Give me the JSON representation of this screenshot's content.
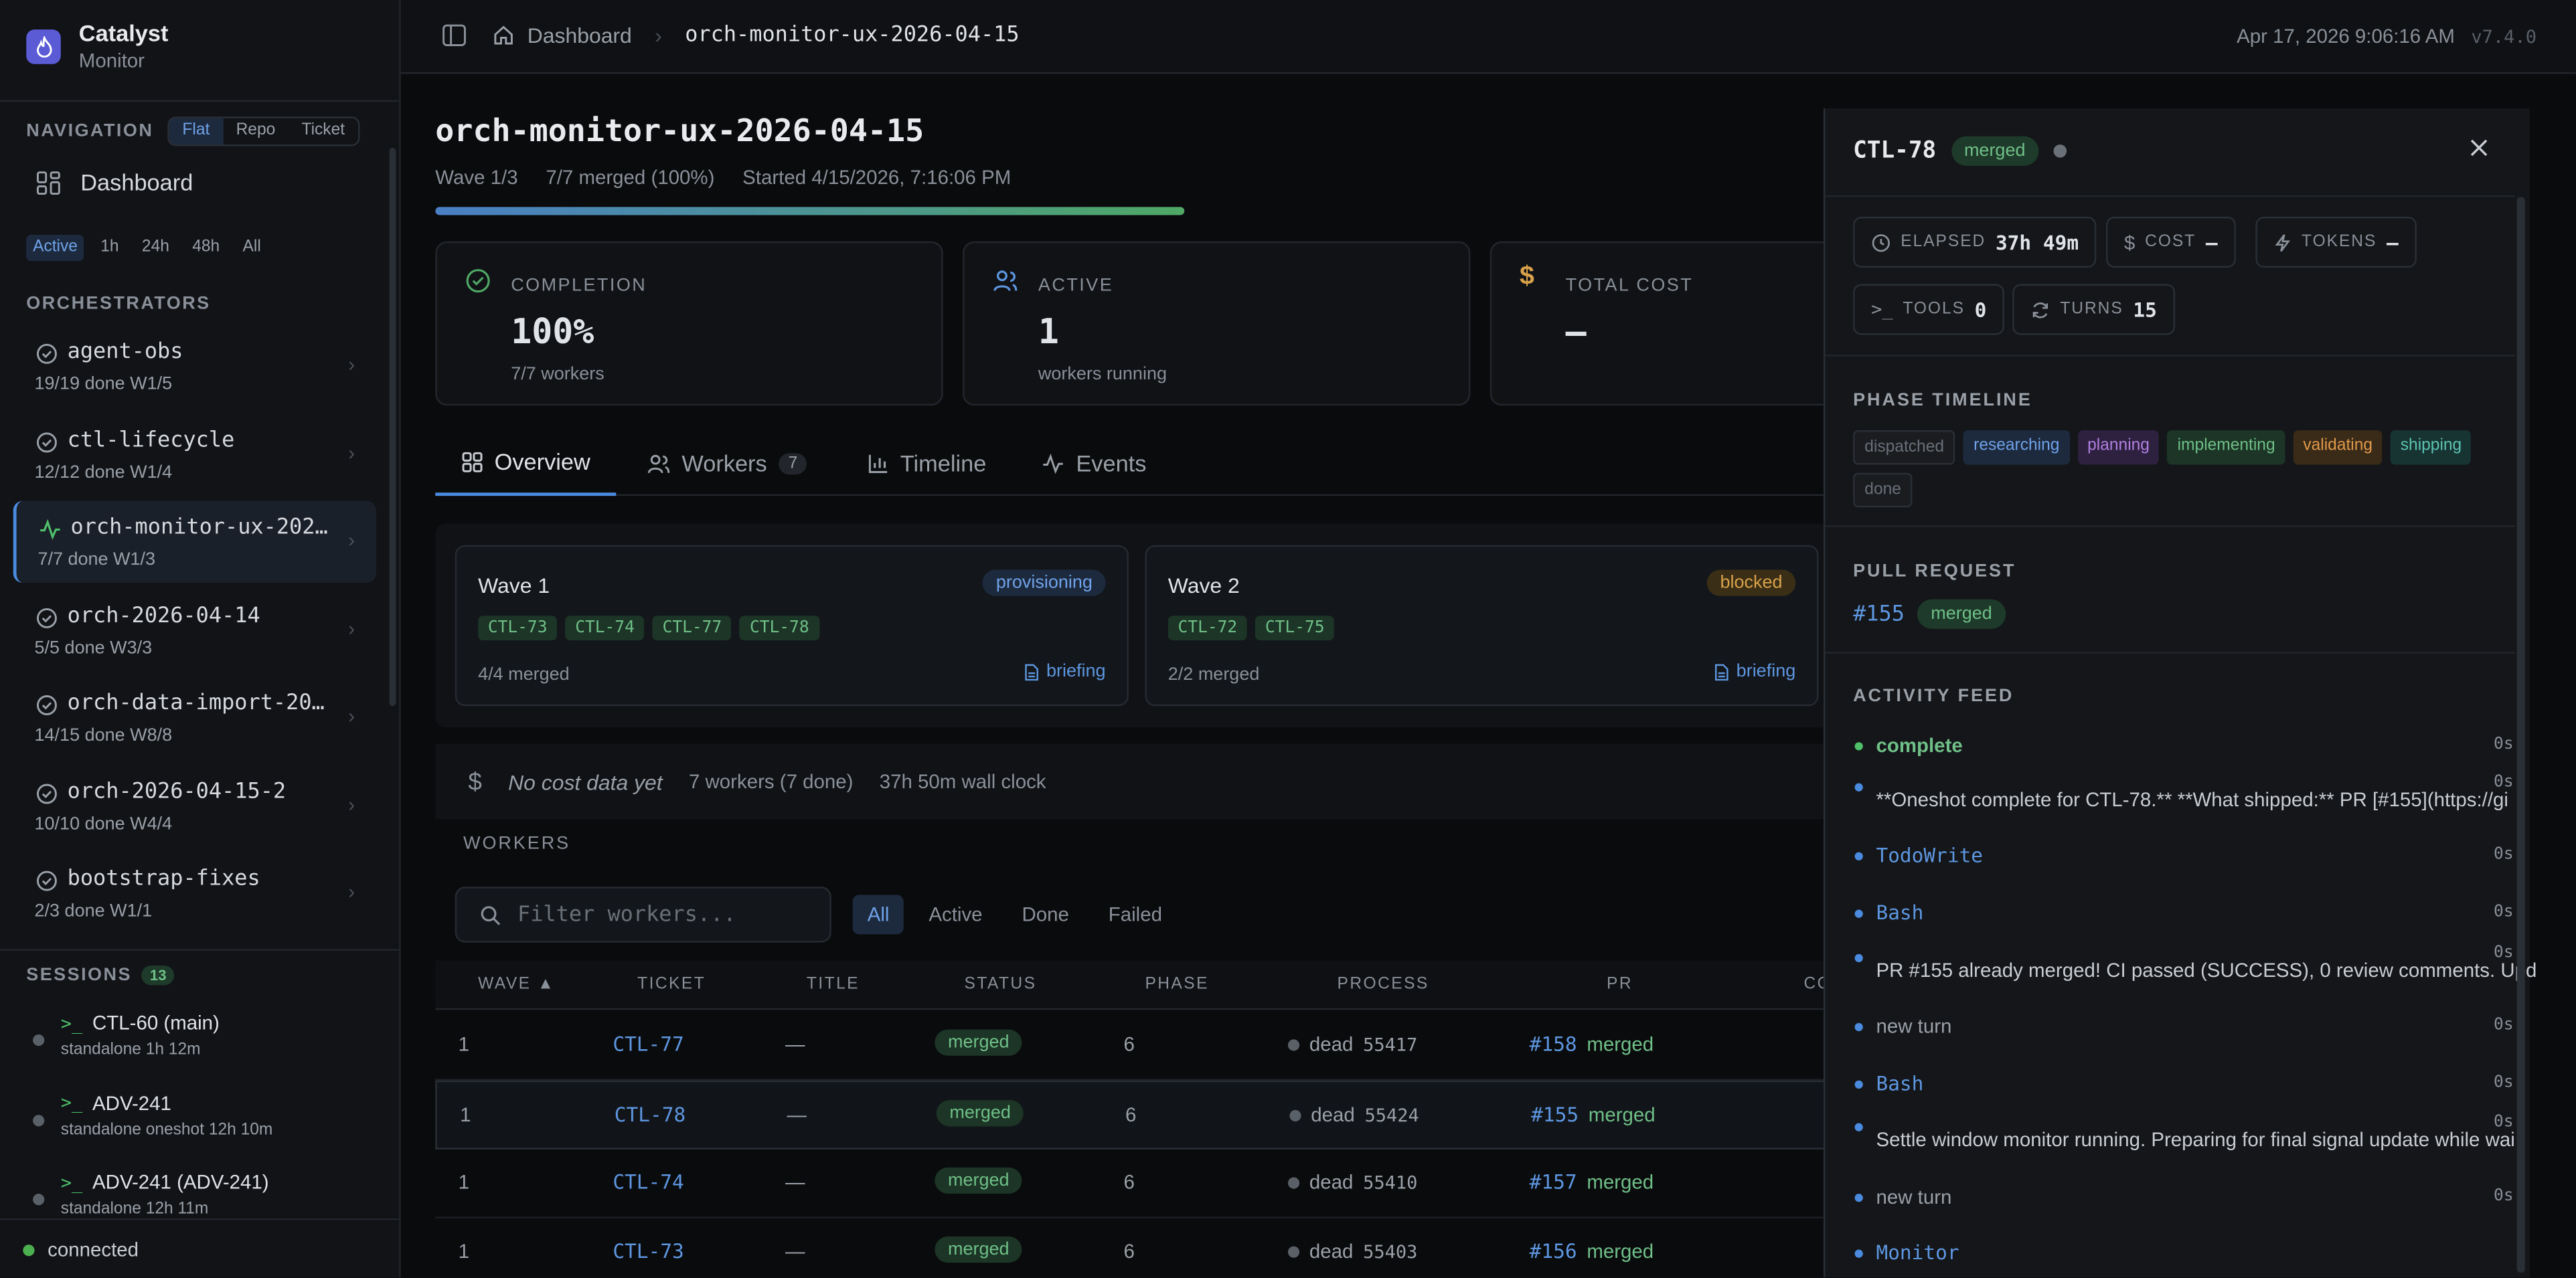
{
  "sidebar": {
    "brand_title": "Catalyst",
    "brand_subtitle": "Monitor",
    "navigation_label": "NAVIGATION",
    "view_modes": [
      "Flat",
      "Repo",
      "Ticket"
    ],
    "view_mode_selected": "Flat",
    "dashboard_label": "Dashboard",
    "time_ranges": [
      "Active",
      "1h",
      "24h",
      "48h",
      "All"
    ],
    "time_range_selected": "Active",
    "orchestrators_label": "ORCHESTRATORS",
    "orchestrators": [
      {
        "name": "agent-obs",
        "meta": "19/19 done  W1/5",
        "icon": "check-circle-icon"
      },
      {
        "name": "ctl-lifecycle",
        "meta": "12/12 done  W1/4",
        "icon": "check-circle-icon"
      },
      {
        "name": "orch-monitor-ux-202…",
        "meta": "7/7 done  W1/3",
        "icon": "activity-icon",
        "selected": true
      },
      {
        "name": "orch-2026-04-14",
        "meta": "5/5 done  W3/3",
        "icon": "check-circle-icon"
      },
      {
        "name": "orch-data-import-20…",
        "meta": "14/15 done  W8/8",
        "icon": "check-circle-icon"
      },
      {
        "name": "orch-2026-04-15-2",
        "meta": "10/10 done  W4/4",
        "icon": "check-circle-icon"
      },
      {
        "name": "bootstrap-fixes",
        "meta": "2/3 done  W1/1",
        "icon": "check-circle-icon"
      }
    ],
    "sessions_label": "SESSIONS",
    "sessions_count": "13",
    "sessions": [
      {
        "title": "CTL-60 (main)",
        "meta": "standalone  1h 12m"
      },
      {
        "title": "ADV-241",
        "meta": "standalone  oneshot  12h 10m"
      },
      {
        "title": "ADV-241 (ADV-241)",
        "meta": "standalone  12h 11m"
      }
    ],
    "connection_status": "connected"
  },
  "topbar": {
    "breadcrumb_home": "Dashboard",
    "breadcrumb_current": "orch-monitor-ux-2026-04-15",
    "datetime": "Apr 17, 2026 9:06:16 AM",
    "version": "v7.4.0"
  },
  "main": {
    "title": "orch-monitor-ux-2026-04-15",
    "wave": "Wave 1/3",
    "merged_summary": "7/7 merged (100%)",
    "started": "Started 4/15/2026, 7:16:06 PM",
    "progress": 1.0,
    "stats": [
      {
        "label": "COMPLETION",
        "value": "100%",
        "sub": "7/7 workers",
        "icon": "check-circle-icon",
        "color": "#4fa865"
      },
      {
        "label": "ACTIVE",
        "value": "1",
        "sub": "workers running",
        "icon": "users-icon",
        "color": "#5d96e0"
      },
      {
        "label": "TOTAL COST",
        "value": "—",
        "sub": "",
        "icon": "dollar-icon",
        "color": "#d8a14a"
      }
    ],
    "tabs": [
      {
        "label": "Overview",
        "icon": "grid-icon"
      },
      {
        "label": "Workers",
        "icon": "users-icon",
        "count": "7"
      },
      {
        "label": "Timeline",
        "icon": "bar-chart-icon"
      },
      {
        "label": "Events",
        "icon": "activity-icon"
      }
    ],
    "waves": [
      {
        "title": "Wave 1",
        "badge": "provisioning",
        "tickets": [
          "CTL-73",
          "CTL-74",
          "CTL-77",
          "CTL-78"
        ],
        "meta": "4/4 merged",
        "link": "briefing"
      },
      {
        "title": "Wave 2",
        "badge": "blocked",
        "tickets": [
          "CTL-72",
          "CTL-75"
        ],
        "meta": "2/2 merged",
        "link": "briefing"
      }
    ],
    "cost_empty": "No cost data yet",
    "cost_workers": "7 workers (7 done)",
    "cost_wall": "37h 50m wall clock",
    "workers_label": "WORKERS",
    "filter_placeholder": "Filter workers...",
    "filters": [
      "All",
      "Active",
      "Done",
      "Failed"
    ],
    "filter_selected": "All",
    "columns": [
      "WAVE ▲",
      "TICKET",
      "TITLE",
      "STATUS",
      "PHASE",
      "PROCESS",
      "PR",
      "CO"
    ],
    "rows": [
      {
        "wave": "1",
        "ticket": "CTL-77",
        "title": "—",
        "status": "merged",
        "phase": "6",
        "proc_state": "dead",
        "pid": "55417",
        "pr": "#158",
        "pr_status": "merged"
      },
      {
        "wave": "1",
        "ticket": "CTL-78",
        "title": "—",
        "status": "merged",
        "phase": "6",
        "proc_state": "dead",
        "pid": "55424",
        "pr": "#155",
        "pr_status": "merged",
        "highlighted": true
      },
      {
        "wave": "1",
        "ticket": "CTL-74",
        "title": "—",
        "status": "merged",
        "phase": "6",
        "proc_state": "dead",
        "pid": "55410",
        "pr": "#157",
        "pr_status": "merged"
      },
      {
        "wave": "1",
        "ticket": "CTL-73",
        "title": "—",
        "status": "merged",
        "phase": "6",
        "proc_state": "dead",
        "pid": "55403",
        "pr": "#156",
        "pr_status": "merged"
      }
    ]
  },
  "drawer": {
    "ticket": "CTL-78",
    "status": "merged",
    "chips": [
      {
        "label": "ELAPSED",
        "value": "37h 49m",
        "icon": "clock-icon"
      },
      {
        "label": "COST",
        "value": "—",
        "icon": "dollar-icon"
      },
      {
        "label": "TOKENS",
        "value": "—",
        "icon": "zap-icon"
      },
      {
        "label": "TOOLS",
        "value": "0",
        "icon": "terminal-icon"
      },
      {
        "label": "TURNS",
        "value": "15",
        "icon": "refresh-icon"
      }
    ],
    "phase_timeline_label": "PHASE TIMELINE",
    "phases": [
      {
        "label": "dispatched",
        "bg": "#1a1c20",
        "fg": "#6a7078"
      },
      {
        "label": "researching",
        "bg": "#1d2a3e",
        "fg": "#6fa2e8"
      },
      {
        "label": "planning",
        "bg": "#2e2140",
        "fg": "#b07fe0"
      },
      {
        "label": "implementing",
        "bg": "#1c3526",
        "fg": "#6fbf87"
      },
      {
        "label": "validating",
        "bg": "#3a2a18",
        "fg": "#e09a4a"
      },
      {
        "label": "shipping",
        "bg": "#173432",
        "fg": "#5cc3b2"
      },
      {
        "label": "done",
        "bg": "#1a1c20",
        "fg": "#6a7078"
      }
    ],
    "pull_request_label": "PULL REQUEST",
    "pr_number": "#155",
    "pr_status": "merged",
    "activity_label": "ACTIVITY FEED",
    "activity": [
      {
        "kind": "complete",
        "text": "complete",
        "ts": "0s"
      },
      {
        "kind": "text",
        "text": "**Oneshot complete for CTL-78.** **What shipped:** PR [#155](https://gi",
        "ts": "0s"
      },
      {
        "kind": "tool",
        "text": "TodoWrite",
        "ts": "0s"
      },
      {
        "kind": "tool",
        "text": "Bash",
        "ts": "0s"
      },
      {
        "kind": "text",
        "text": "PR #155 already merged! CI passed (SUCCESS), 0 review comments. Upd",
        "ts": "0s"
      },
      {
        "kind": "muted",
        "text": "new turn",
        "ts": "0s"
      },
      {
        "kind": "tool",
        "text": "Bash",
        "ts": "0s"
      },
      {
        "kind": "text",
        "text": "Settle window monitor running. Preparing for final signal update while wai",
        "ts": "0s"
      },
      {
        "kind": "muted",
        "text": "new turn",
        "ts": "0s"
      },
      {
        "kind": "tool",
        "text": "Monitor",
        "ts": ""
      }
    ]
  }
}
